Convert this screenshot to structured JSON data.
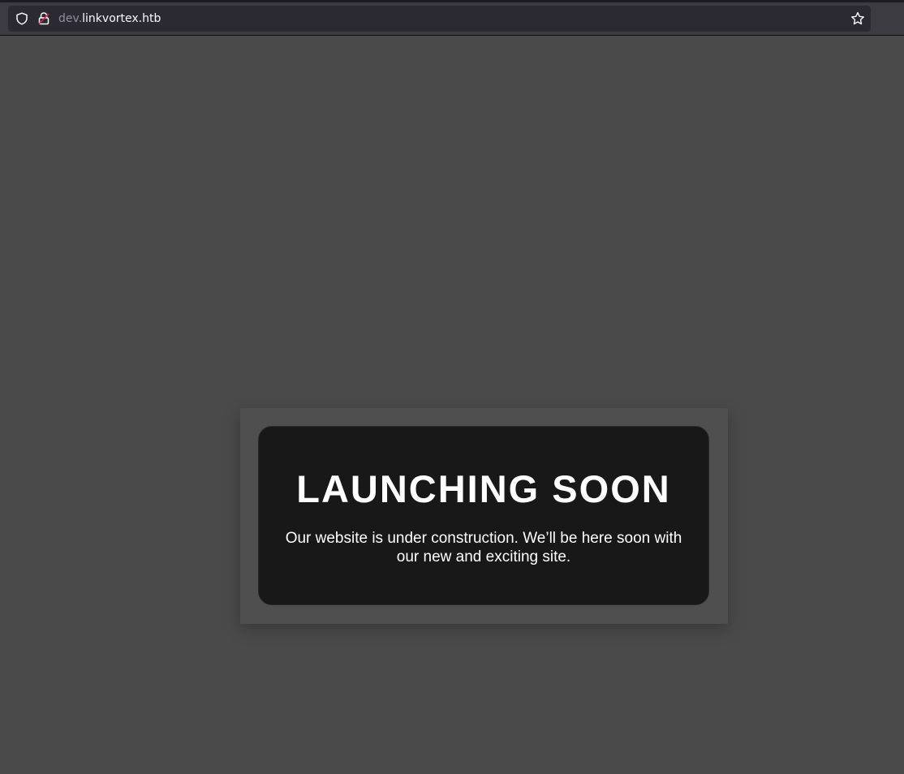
{
  "browser": {
    "url_subdomain": "dev.",
    "url_domain": "linkvortex.htb"
  },
  "page": {
    "heading": "LAUNCHING SOON",
    "message": "Our website is under construction. We’ll be here soon with our new and exciting site."
  },
  "colors": {
    "page_background": "#4a4a4a",
    "card_background": "#181818",
    "text": "#ffffff"
  },
  "icons": {
    "tracking_protection": "shield-icon",
    "connection": "lock-icon",
    "bookmark": "star-icon"
  }
}
